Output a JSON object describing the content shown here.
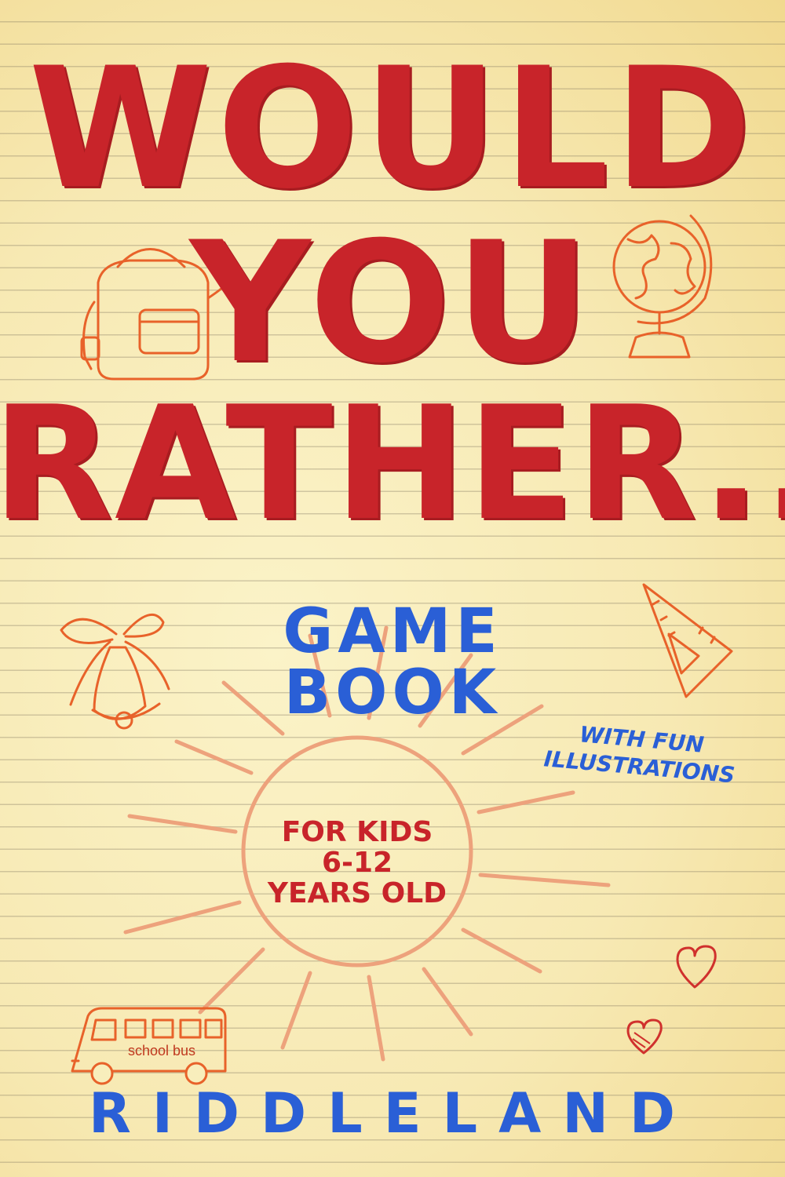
{
  "title": {
    "line1": "WOULD",
    "line2": "YOU",
    "line3": "RATHER...."
  },
  "subtitle": "GAME BOOK",
  "badge": {
    "line1": "WITH FUN",
    "line2": "ILLUSTRATIONS"
  },
  "audience": {
    "line1": "FOR KIDS",
    "line2": "6-12",
    "line3": "YEARS OLD"
  },
  "bus_label": "school bus",
  "brand": "RIDDLELAND",
  "doodles": [
    "backpack-icon",
    "globe-icon",
    "bell-icon",
    "set-square-icon",
    "sun-doodle",
    "heart-icon",
    "heart-icon",
    "school-bus-icon"
  ],
  "colors": {
    "title_red": "#c8242a",
    "blue": "#2a5fd6",
    "doodle_orange": "#e8622a",
    "paper": "#f8eebc"
  }
}
